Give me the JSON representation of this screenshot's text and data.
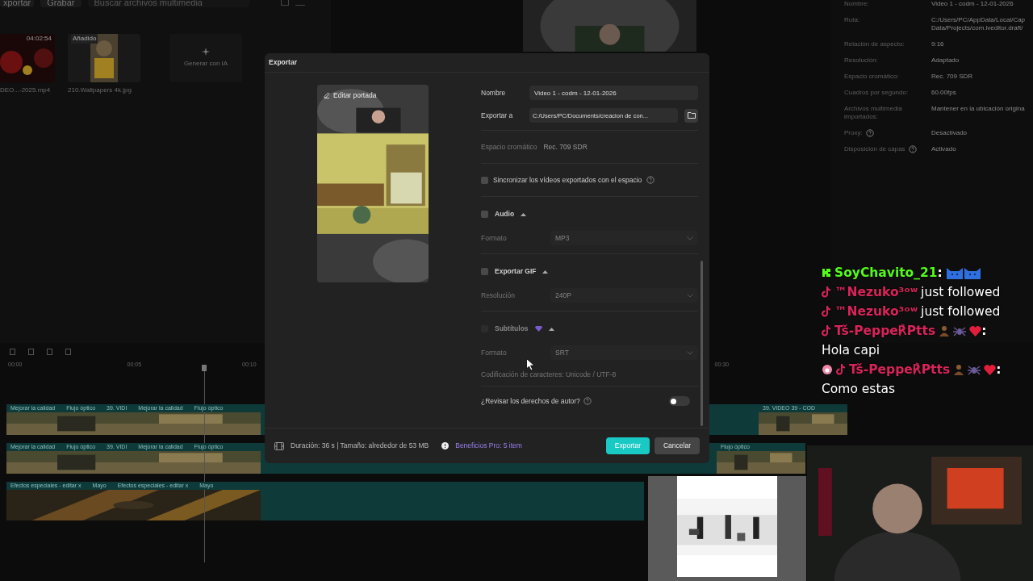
{
  "editor": {
    "toolbar": {
      "import_label": "xportar",
      "record_label": "Grabar",
      "search_placeholder": "Buscar archivos multimedia"
    },
    "media": [
      {
        "kind": "video",
        "duration": "04:02:54",
        "name": "DEO...-2025.mp4"
      },
      {
        "badge": "Añadido",
        "name": "210.Wallpapers 4k.jpg"
      },
      {
        "kind": "generate",
        "label": "Generar con IA"
      }
    ],
    "properties": [
      {
        "label": "Nombre:",
        "lines": [
          "Video 1 - codm - 12-01-2026"
        ]
      },
      {
        "label": "Ruta:",
        "lines": [
          "C:/Users/PC/AppData/Local/Cap",
          "Data/Projects/com.lveditor.draft/"
        ]
      },
      {
        "label": "Relación de aspecto:",
        "lines": [
          "9:16"
        ]
      },
      {
        "label": "Resolución:",
        "lines": [
          "Adaptado"
        ]
      },
      {
        "label": "Espacio cromático:",
        "lines": [
          "Rec. 709 SDR"
        ]
      },
      {
        "label": "Cuadros por segundo:",
        "lines": [
          "60.00fps"
        ]
      },
      {
        "label": "Archivos multimedia importados:",
        "lines": [
          "Mantener en la ubicación origina"
        ]
      },
      {
        "label": "Proxy:",
        "lines": [
          "Desactivado"
        ],
        "help": true
      },
      {
        "label": "Disposición de capas",
        "lines": [
          "Activado"
        ],
        "help": true
      }
    ],
    "timeline": {
      "ticks": [
        "00:00",
        "00:05",
        "00:10",
        "00:30"
      ],
      "tracks": [
        {
          "kind": "video",
          "segments": [
            {
              "clips": [
                "Mejorar la calidad",
                "Flujo óptico",
                "39. VIDI",
                "Mejorar la calidad",
                "Flujo óptico"
              ]
            },
            {
              "clips": [
                "39. VIDEO 39 - COD"
              ]
            }
          ]
        },
        {
          "kind": "video",
          "segments": [
            {
              "clips": [
                "Mejorar la calidad",
                "Flujo óptico",
                "39. VIDI",
                "Mejorar la calidad",
                "Flujo óptico"
              ]
            },
            {
              "clips": [
                "Flujo óptico"
              ]
            }
          ]
        },
        {
          "kind": "effects",
          "segments": [
            {
              "clips": [
                "Efectos especiales - editar x",
                "Mayo",
                "Efectos especiales - editar x",
                "Mayo"
              ]
            }
          ]
        }
      ]
    }
  },
  "dialog": {
    "title": "Exportar",
    "cover_button": "Editar portada",
    "rows": [
      {
        "kind": "field",
        "label": "Nombre",
        "value": "Video 1 - codm - 12-01-2026"
      },
      {
        "kind": "path",
        "label": "Exportar a",
        "value": "C:/Users/PC/Documents/creacion de con..."
      },
      {
        "kind": "info",
        "label": "Espacio cromático",
        "value": "Rec. 709 SDR"
      },
      {
        "kind": "checkbox",
        "label": "Sincronizar los vídeos exportados con el espacio",
        "checked": false
      },
      {
        "kind": "section",
        "title": "Audio",
        "checked": false,
        "expanded": true,
        "disabled": false,
        "pro": false,
        "fields": [
          {
            "kind": "select",
            "label": "Formato",
            "value": "MP3"
          }
        ]
      },
      {
        "kind": "section",
        "title": "Exportar GIF",
        "checked": false,
        "expanded": true,
        "disabled": false,
        "pro": false,
        "fields": [
          {
            "kind": "select",
            "label": "Resolución",
            "value": "240P"
          }
        ]
      },
      {
        "kind": "section",
        "title": "Subtítulos",
        "checked": false,
        "expanded": true,
        "disabled": true,
        "pro": true,
        "fields": [
          {
            "kind": "select",
            "label": "Formato",
            "value": "SRT"
          },
          {
            "kind": "note",
            "label": "Codificación de caracteres:",
            "value": "Unicode / UTF-8"
          }
        ]
      },
      {
        "kind": "toggle",
        "label": "¿Revisar los derechos de autor?",
        "on": false
      }
    ],
    "summary": "Duración: 36 s | Tamaño: alrededor de 53 MB",
    "pro_link": "Beneficios Pro: 5 item",
    "buttons": [
      {
        "kind": "primary",
        "label": "Exportar"
      },
      {
        "kind": "secondary",
        "label": "Cancelar"
      }
    ]
  },
  "chat": [
    {
      "kind": "emote",
      "kick": true,
      "user": "SoyChavito_21",
      "color": "#53fc18",
      "separator": ":"
    },
    {
      "kind": "follow",
      "kick": false,
      "user": "™Nezuko³ᵒʷ",
      "color": "#d9245a",
      "text": "just followed"
    },
    {
      "kind": "follow",
      "kick": false,
      "user": "™Nezuko³ᵒʷ",
      "color": "#d9245a",
      "text": "just followed"
    },
    {
      "kind": "chat",
      "kick": false,
      "user": "Tš-Peppe℟Ptts",
      "color": "#d9245a",
      "separator": ":",
      "text": "Hola capi",
      "badge": false
    },
    {
      "kind": "chat",
      "kick": false,
      "user": "Tš-Peppe℟Ptts",
      "color": "#d9245a",
      "separator": ":",
      "text": "Como estas",
      "badge": true
    }
  ]
}
